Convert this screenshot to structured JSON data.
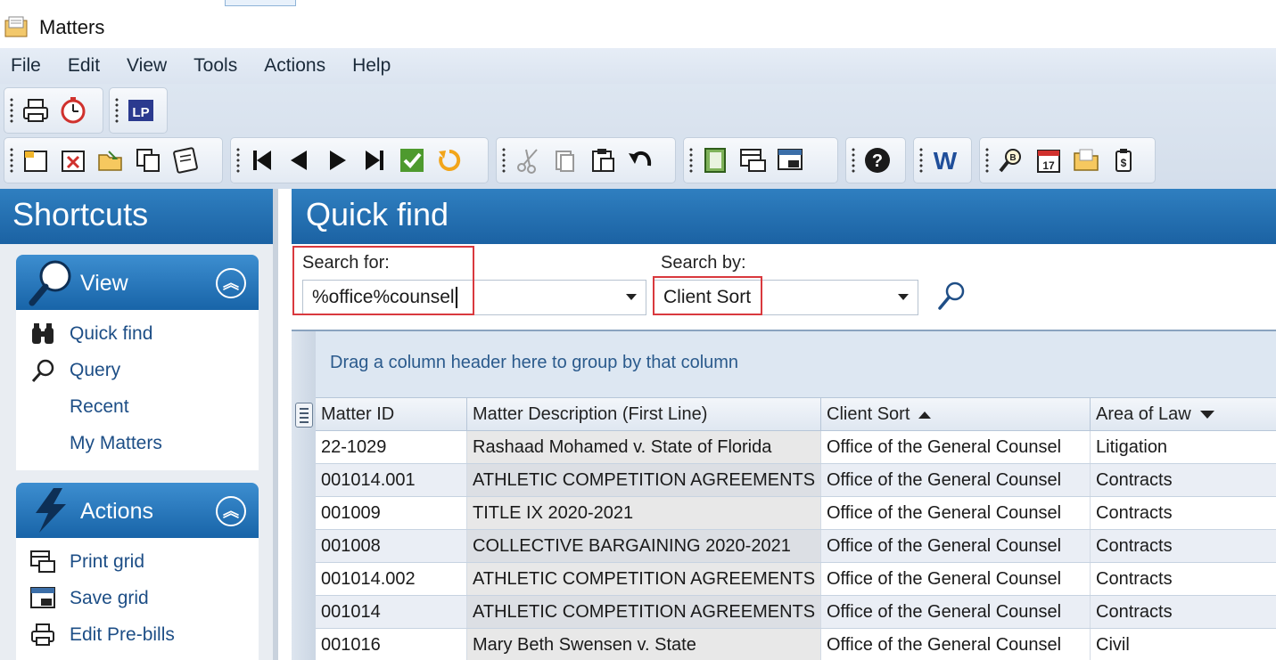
{
  "window": {
    "title": "Matters"
  },
  "menu": [
    "File",
    "Edit",
    "View",
    "Tools",
    "Actions",
    "Help"
  ],
  "toolbar_icons": {
    "row1": [
      "print-icon",
      "timer-icon",
      "lp-icon"
    ],
    "row2_group1": [
      "new-icon",
      "delete-icon",
      "open-icon",
      "copy-record-icon",
      "notes-icon"
    ],
    "row2_group2": [
      "first-record-icon",
      "previous-record-icon",
      "next-record-icon",
      "last-record-icon",
      "save-check-icon",
      "refresh-icon"
    ],
    "row2_group3": [
      "cut-icon",
      "copy-icon",
      "paste-icon",
      "undo-icon"
    ],
    "row2_group4": [
      "notebook-icon",
      "print-grid-icon",
      "save-grid-icon"
    ],
    "row2_group5": [
      "help-icon"
    ],
    "row2_group6": [
      "word-icon"
    ],
    "row2_group7": [
      "search-db-icon",
      "calendar-icon",
      "folder-icon",
      "billing-icon"
    ]
  },
  "lp_label": "LP",
  "calendar_day": "17",
  "word_label": "W",
  "sidebar": {
    "title": "Shortcuts",
    "view_panel": {
      "title": "View",
      "items": [
        {
          "label": "Quick find",
          "icon": "binoculars-icon"
        },
        {
          "label": "Query",
          "icon": "magnifier-icon"
        },
        {
          "label": "Recent",
          "icon": ""
        },
        {
          "label": "My Matters",
          "icon": ""
        }
      ]
    },
    "actions_panel": {
      "title": "Actions",
      "items": [
        {
          "label": "Print grid",
          "icon": "print-grid-icon"
        },
        {
          "label": "Save grid",
          "icon": "save-grid-icon"
        },
        {
          "label": "Edit Pre-bills",
          "icon": "printer-icon"
        }
      ]
    }
  },
  "quickfind": {
    "title": "Quick find",
    "search_for_label": "Search for:",
    "search_for_value": "%office%counsel",
    "search_by_label": "Search by:",
    "search_by_value": "Client Sort"
  },
  "grid": {
    "group_hint": "Drag a column header here to group by that column",
    "columns": [
      "Matter ID",
      "Matter Description (First Line)",
      "Client Sort",
      "Area of Law"
    ],
    "rows": [
      [
        "22-1029",
        "Rashaad Mohamed v. State of Florida",
        "Office of the General Counsel",
        "Litigation"
      ],
      [
        "001014.001",
        "ATHLETIC COMPETITION AGREEMENTS",
        "Office of the General Counsel",
        "Contracts"
      ],
      [
        "001009",
        "TITLE IX 2020-2021",
        "Office of the General Counsel",
        "Contracts"
      ],
      [
        "001008",
        "COLLECTIVE BARGAINING 2020-2021",
        "Office of the General Counsel",
        "Contracts"
      ],
      [
        "001014.002",
        "ATHLETIC COMPETITION AGREEMENTS",
        "Office of the General Counsel",
        "Contracts"
      ],
      [
        "001014",
        "ATHLETIC COMPETITION AGREEMENTS",
        "Office of the General Counsel",
        "Contracts"
      ],
      [
        "001016",
        "Mary Beth Swensen v. State",
        "Office of the General Counsel",
        "Civil"
      ]
    ]
  },
  "colors": {
    "accent": "#1b62a3",
    "highlight_box": "#d9393e"
  }
}
